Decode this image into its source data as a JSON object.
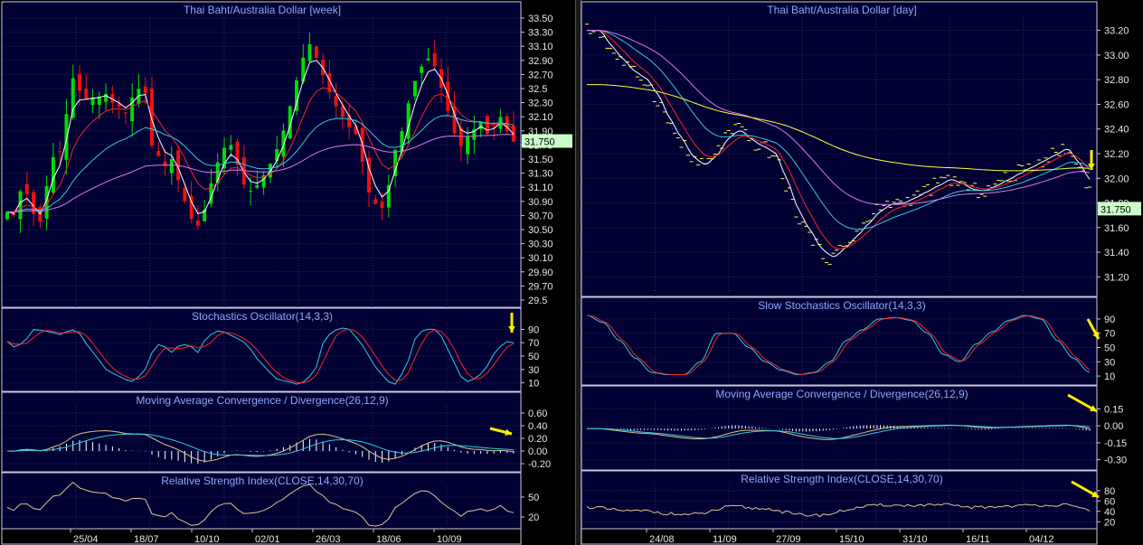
{
  "colors": {
    "panel_bg": "#000033",
    "grid": "#2a2a66",
    "border": "#c8c8e0",
    "title": "#8fa6ff",
    "axis_text": "#e8e8e8",
    "up": "#00dd00",
    "down": "#ee1111",
    "white": "#ffffff",
    "red": "#ff2222",
    "cyan": "#33ccdd",
    "magenta": "#dd77ee",
    "yellow": "#ffff33",
    "rsi": "#d9c78a",
    "price_tag_bg": "#c8ffc8",
    "arrow": "#ffee00"
  },
  "left": {
    "panels": {
      "price": {
        "title": "Thai Baht/Australia Dollar [week]",
        "ticks": [
          "33.50",
          "33.30",
          "33.10",
          "32.90",
          "32.70",
          "32.5",
          "32.30",
          "32.10",
          "31.90",
          "31.70",
          "31.50",
          "31.30",
          "31.10",
          "30.90",
          "30.70",
          "30.50",
          "30.30",
          "30.10",
          "29.90",
          "29.70",
          "29.5"
        ],
        "last_price": "31.750"
      },
      "stoch": {
        "title": "Stochastics Oscillator(14,3,3)",
        "ticks": [
          "90",
          "70",
          "50",
          "30",
          "10"
        ]
      },
      "macd": {
        "title": "Moving Average Convergence / Divergence(26,12,9)",
        "ticks": [
          "0.60",
          "0.40",
          "0.20",
          "0.00",
          "-0.20"
        ]
      },
      "rsi": {
        "title": "Relative Strength Index(CLOSE,14,30,70)",
        "ticks": [
          "50",
          "20"
        ]
      }
    },
    "dates": [
      "25/04",
      "18/07",
      "10/10",
      "02/01",
      "26/03",
      "18/06",
      "10/09"
    ]
  },
  "right": {
    "panels": {
      "price": {
        "title": "Thai Baht/Australia Dollar [day]",
        "ticks": [
          "33.20",
          "33.00",
          "32.80",
          "32.60",
          "32.40",
          "32.20",
          "32.00",
          "31.80",
          "31.60",
          "31.40",
          "31.20"
        ],
        "last_price": "31.750"
      },
      "stoch": {
        "title": "Slow Stochastics Oscillator(14,3,3)",
        "ticks": [
          "90",
          "70",
          "50",
          "30",
          "10"
        ]
      },
      "macd": {
        "title": "Moving Average Convergence / Divergence(26,12,9)",
        "ticks": [
          "0.15",
          "0.00",
          "-0.15",
          "-0.30"
        ]
      },
      "rsi": {
        "title": "Relative Strength Index(CLOSE,14,30,70)",
        "ticks": [
          "80",
          "60",
          "40",
          "20"
        ]
      }
    },
    "dates": [
      "24/08",
      "11/09",
      "27/09",
      "15/10",
      "31/10",
      "16/11",
      "04/12"
    ]
  },
  "chart_data": [
    {
      "type": "candlestick",
      "title": "Thai Baht/Australia Dollar [week]",
      "interval": "week",
      "ylim": [
        29.5,
        33.5
      ],
      "x_tick_labels": [
        "25/04",
        "18/07",
        "10/10",
        "02/01",
        "26/03",
        "18/06",
        "10/09"
      ],
      "close_profile": [
        30.75,
        30.7,
        31.05,
        31.0,
        30.7,
        30.6,
        31.2,
        31.6,
        31.6,
        32.35,
        32.8,
        32.25,
        32.45,
        32.3,
        32.5,
        32.3,
        32.3,
        32.1,
        32.35,
        32.5,
        32.5,
        31.7,
        31.55,
        31.4,
        31.5,
        31.2,
        30.9,
        30.65,
        30.55,
        30.8,
        31.2,
        31.5,
        31.7,
        31.7,
        31.3,
        31.05,
        31.05,
        31.2,
        31.35,
        31.55,
        31.8,
        32.15,
        32.55,
        32.9,
        33.15,
        32.95,
        32.7,
        32.45,
        32.25,
        32.1,
        31.95,
        31.85,
        31.45,
        31.0,
        30.85,
        30.8,
        31.2,
        31.75,
        31.95,
        32.45,
        32.7,
        32.9,
        32.95,
        32.65,
        32.3,
        31.95,
        31.65,
        31.8,
        31.9,
        32.05,
        31.85,
        31.95,
        32.1,
        31.9,
        31.75
      ],
      "last_price": 31.75,
      "overlays": [
        "white (fast average)",
        "red",
        "cyan",
        "magenta"
      ],
      "indicators": {
        "stochastics_14_3_3": {
          "k_profile": [
            72,
            62,
            75,
            90,
            88,
            85,
            82,
            90,
            84,
            65,
            45,
            30,
            22,
            15,
            12,
            25,
            55,
            70,
            55,
            65,
            68,
            55,
            75,
            88,
            86,
            80,
            72,
            60,
            40,
            25,
            15,
            12,
            8,
            12,
            30,
            70,
            88,
            92,
            90,
            70,
            50,
            30,
            12,
            8,
            30,
            75,
            88,
            92,
            80,
            55,
            20,
            12,
            18,
            35,
            55,
            72,
            70
          ]
        },
        "macd_26_12_9": {
          "ylim": [
            -0.3,
            0.7
          ]
        },
        "rsi_14_30_70": {
          "value_last": 50
        }
      }
    },
    {
      "type": "candlestick",
      "title": "Thai Baht/Australia Dollar [day]",
      "interval": "day",
      "ylim": [
        31.1,
        33.3
      ],
      "x_tick_labels": [
        "24/08",
        "11/09",
        "27/09",
        "15/10",
        "31/10",
        "16/11",
        "04/12"
      ],
      "close_profile": [
        33.2,
        33.2,
        33.05,
        32.95,
        32.85,
        32.8,
        32.65,
        32.45,
        32.3,
        32.15,
        32.1,
        32.2,
        32.35,
        32.4,
        32.3,
        32.25,
        32.2,
        31.95,
        31.7,
        31.55,
        31.4,
        31.35,
        31.45,
        31.55,
        31.65,
        31.75,
        31.8,
        31.8,
        31.85,
        31.9,
        31.95,
        32.0,
        31.95,
        31.9,
        31.9,
        31.95,
        32.0,
        32.05,
        32.1,
        32.15,
        32.2,
        32.25,
        32.1,
        31.95
      ],
      "last_price": 31.75,
      "overlays": [
        "white",
        "red",
        "cyan",
        "magenta",
        "yellow"
      ],
      "indicators": {
        "slow_stochastics_14_3_3": {
          "k_profile": [
            95,
            85,
            60,
            35,
            15,
            12,
            12,
            30,
            70,
            70,
            50,
            30,
            18,
            12,
            15,
            30,
            60,
            75,
            90,
            92,
            88,
            70,
            40,
            30,
            55,
            72,
            88,
            95,
            90,
            60,
            35,
            15
          ]
        },
        "macd_26_12_9": {
          "ylim": [
            -0.35,
            0.25
          ]
        },
        "rsi_14_30_70": {
          "value_last": 38
        }
      }
    }
  ]
}
